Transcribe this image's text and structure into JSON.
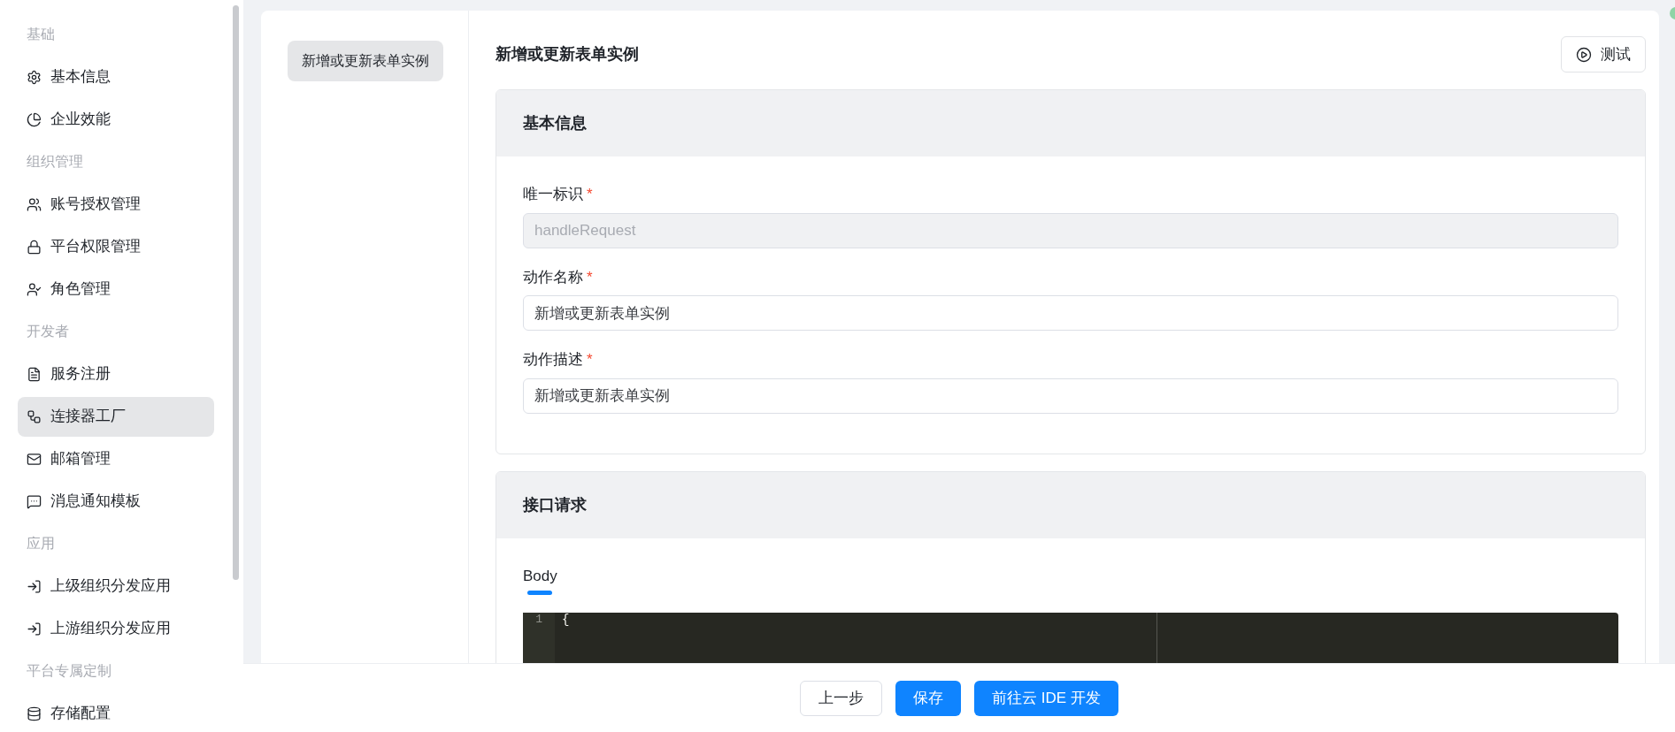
{
  "sidebar": {
    "groups": [
      {
        "label": "基础",
        "items": [
          {
            "label": "基本信息",
            "selected": false
          },
          {
            "label": "企业效能",
            "selected": false
          }
        ]
      },
      {
        "label": "组织管理",
        "items": [
          {
            "label": "账号授权管理",
            "selected": false
          },
          {
            "label": "平台权限管理",
            "selected": false
          },
          {
            "label": "角色管理",
            "selected": false
          }
        ]
      },
      {
        "label": "开发者",
        "items": [
          {
            "label": "服务注册",
            "selected": false
          },
          {
            "label": "连接器工厂",
            "selected": true
          },
          {
            "label": "邮箱管理",
            "selected": false
          },
          {
            "label": "消息通知模板",
            "selected": false
          }
        ]
      },
      {
        "label": "应用",
        "items": [
          {
            "label": "上级组织分发应用",
            "selected": false
          },
          {
            "label": "上游组织分发应用",
            "selected": false
          }
        ]
      },
      {
        "label": "平台专属定制",
        "items": [
          {
            "label": "存储配置",
            "selected": false
          }
        ]
      }
    ]
  },
  "action_list": [
    {
      "label": "新增或更新表单实例",
      "selected": true
    }
  ],
  "page_title": "新增或更新表单实例",
  "test_button": "测试",
  "sections": [
    {
      "kind": "form",
      "title": "基本信息",
      "fields": [
        {
          "label": "唯一标识",
          "required_mark": "*",
          "value": "handleRequest",
          "disabled": true
        },
        {
          "label": "动作名称",
          "required_mark": "*",
          "value": "新增或更新表单实例",
          "disabled": false
        },
        {
          "label": "动作描述",
          "required_mark": "*",
          "value": "新增或更新表单实例",
          "disabled": false
        }
      ]
    },
    {
      "kind": "request",
      "title": "接口请求",
      "tabs": [
        {
          "label": "Body",
          "selected": true
        }
      ],
      "code_lines": [
        {
          "number": "1",
          "text": "{"
        }
      ]
    }
  ],
  "footer_buttons": [
    {
      "label": "上一步",
      "kind": "secondary"
    },
    {
      "label": "保存",
      "kind": "primary"
    },
    {
      "label": "前往云 IDE 开发",
      "kind": "primary"
    }
  ]
}
